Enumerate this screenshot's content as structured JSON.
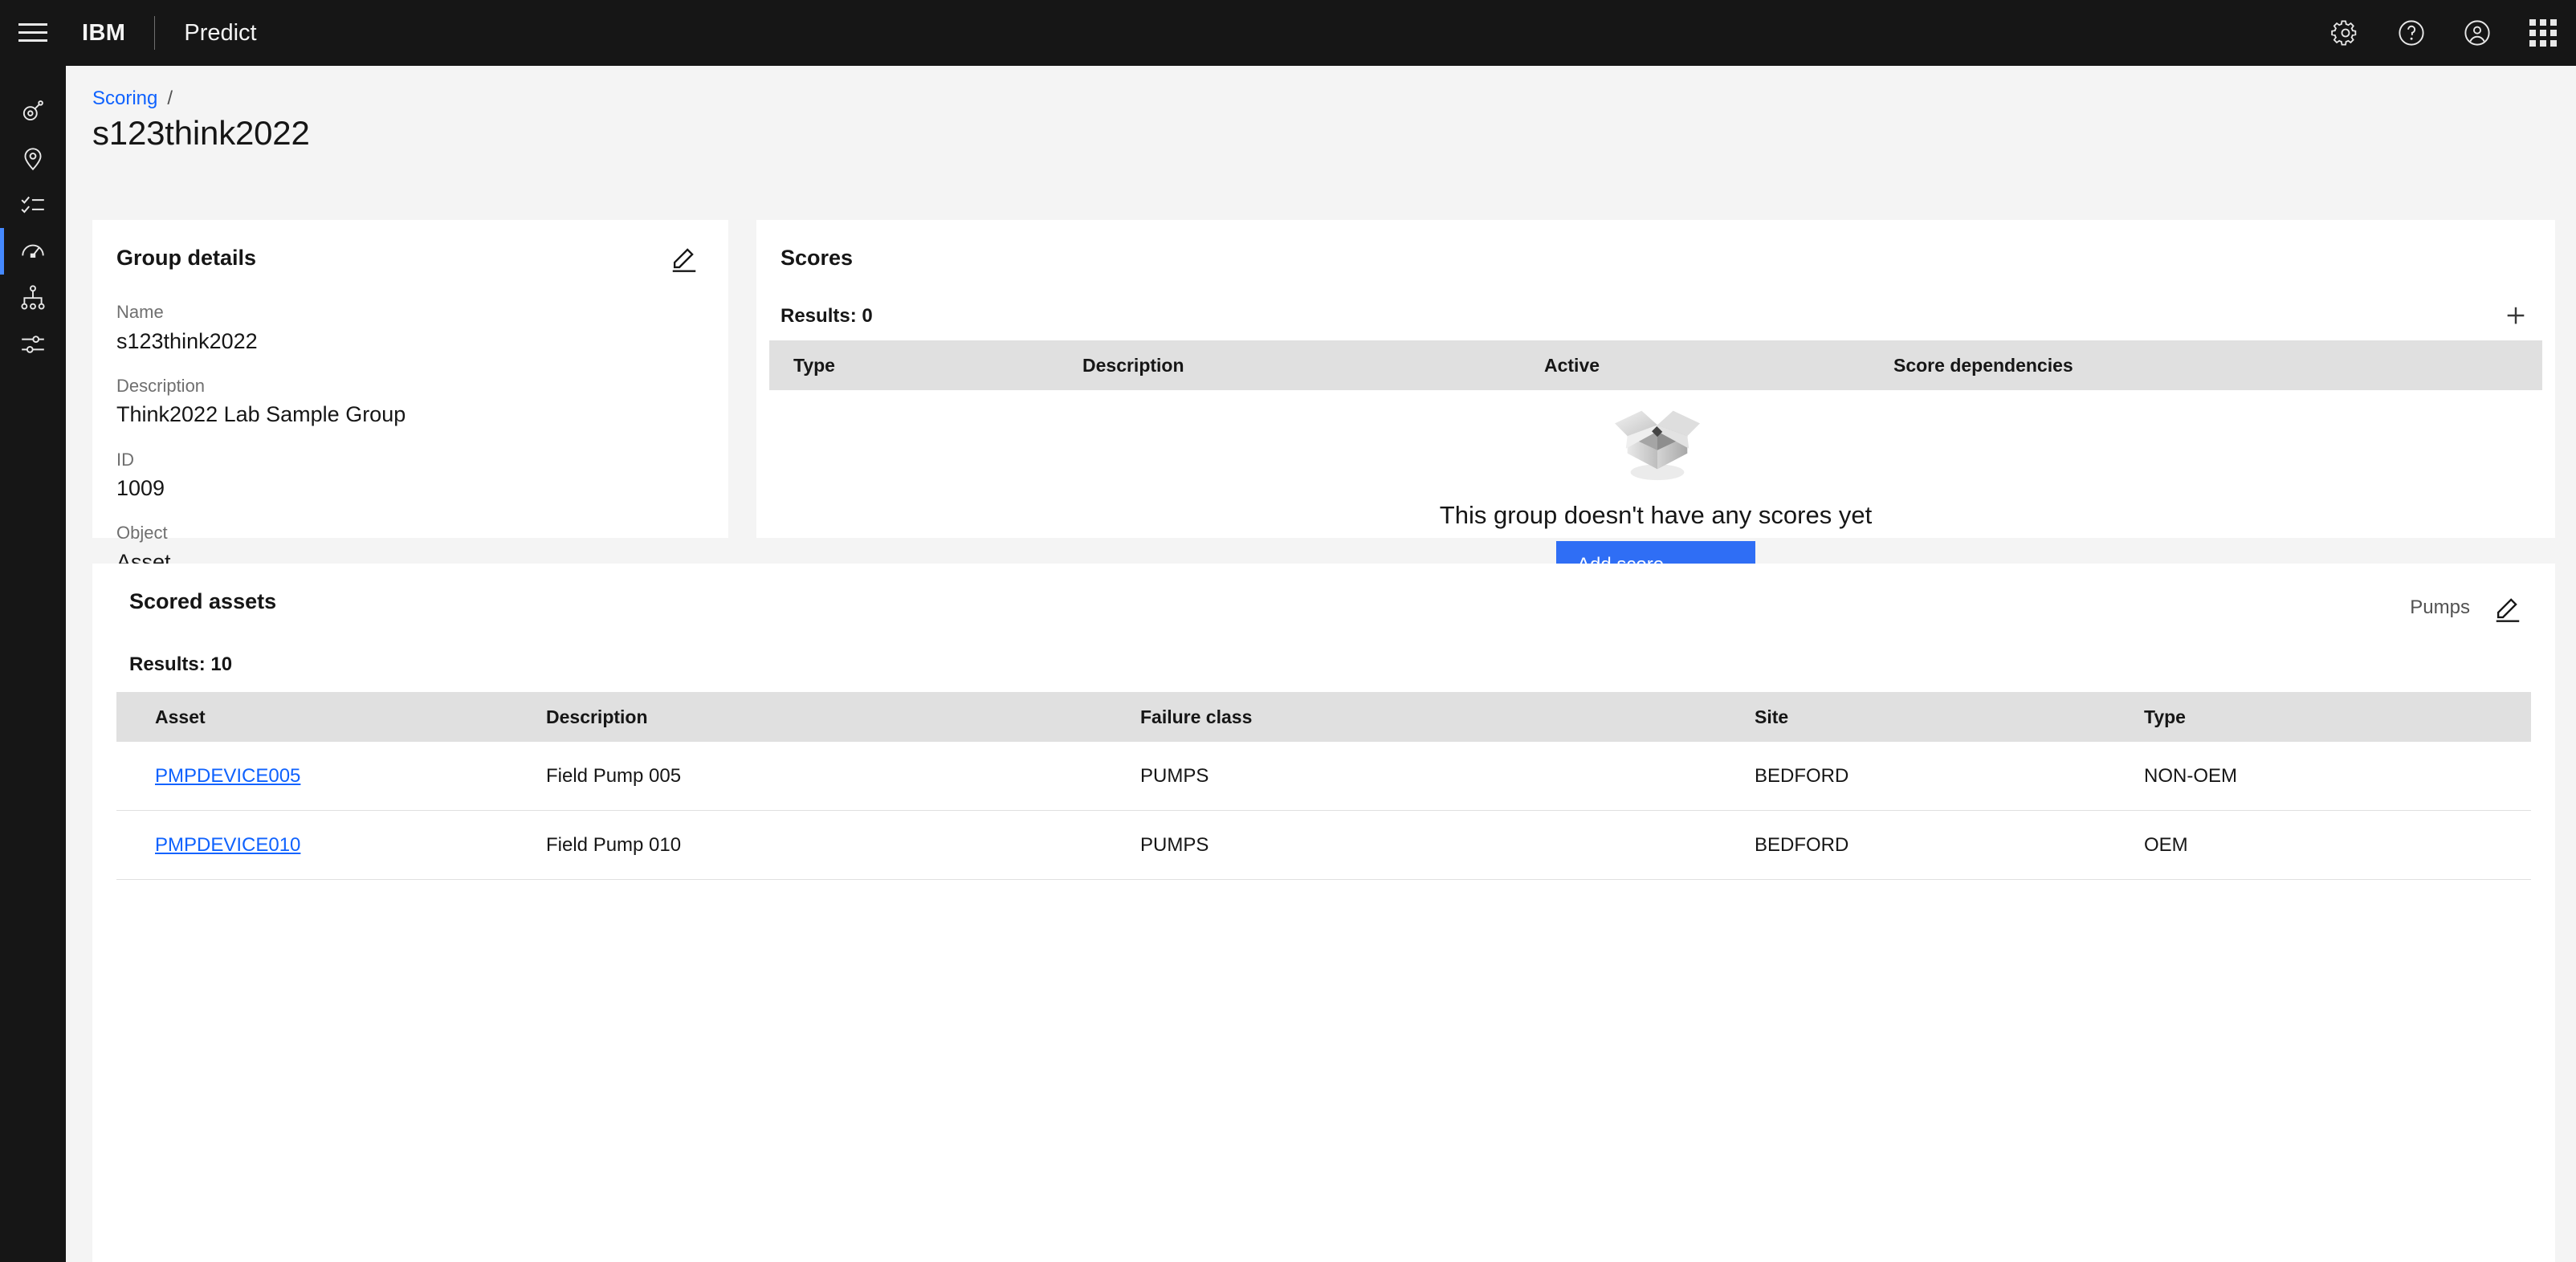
{
  "header": {
    "menu_icon": "hamburger-menu-icon",
    "brand": "IBM",
    "product": "Predict",
    "icons": [
      "gear-icon",
      "help-icon",
      "user-avatar-icon",
      "app-switcher-icon"
    ]
  },
  "left_rail": {
    "items": [
      {
        "icon": "asset-icon",
        "active": false
      },
      {
        "icon": "location-pin-icon",
        "active": false
      },
      {
        "icon": "task-list-icon",
        "active": false
      },
      {
        "icon": "gauge-scoring-icon",
        "active": true
      },
      {
        "icon": "hierarchy-icon",
        "active": false
      },
      {
        "icon": "settings-sliders-icon",
        "active": false
      }
    ]
  },
  "breadcrumb": {
    "link": "Scoring",
    "separator": "/"
  },
  "page_title": "s123think2022",
  "group_details": {
    "title": "Group details",
    "edit_icon": "edit-pencil-icon",
    "fields": [
      {
        "label": "Name",
        "value": "s123think2022"
      },
      {
        "label": "Description",
        "value": "Think2022 Lab Sample Group"
      },
      {
        "label": "ID",
        "value": "1009"
      },
      {
        "label": "Object",
        "value": "Asset"
      }
    ]
  },
  "scores": {
    "title": "Scores",
    "results": "Results: 0",
    "add_icon": "plus-icon",
    "columns": [
      "Type",
      "Description",
      "Active",
      "Score dependencies"
    ],
    "rows": [],
    "empty_state": {
      "illustration": "empty-box-icon",
      "message": "This group doesn't have any scores yet",
      "button_label": "Add score"
    }
  },
  "annotation": {
    "arrow": "annotation-arrow",
    "highlight": "annotation-highlight-box",
    "color": "#0433e5"
  },
  "scored_assets": {
    "title": "Scored assets",
    "filter_label": "Pumps",
    "edit_icon": "edit-pencil-icon",
    "results": "Results: 10",
    "columns": [
      "Asset",
      "Description",
      "Failure class",
      "Site",
      "Type"
    ],
    "rows": [
      {
        "asset": "PMPDEVICE005",
        "description": "Field Pump 005",
        "failure_class": "PUMPS",
        "site": "BEDFORD",
        "type": "NON-OEM"
      },
      {
        "asset": "PMPDEVICE010",
        "description": "Field Pump 010",
        "failure_class": "PUMPS",
        "site": "BEDFORD",
        "type": "OEM"
      }
    ]
  },
  "colors": {
    "header_bg": "#161616",
    "page_bg": "#f4f4f4",
    "card_bg": "#ffffff",
    "link": "#0f62fe",
    "table_header_bg": "#e0e0e0",
    "accent_active": "#4589ff",
    "button_primary": "#2f6ef5"
  }
}
